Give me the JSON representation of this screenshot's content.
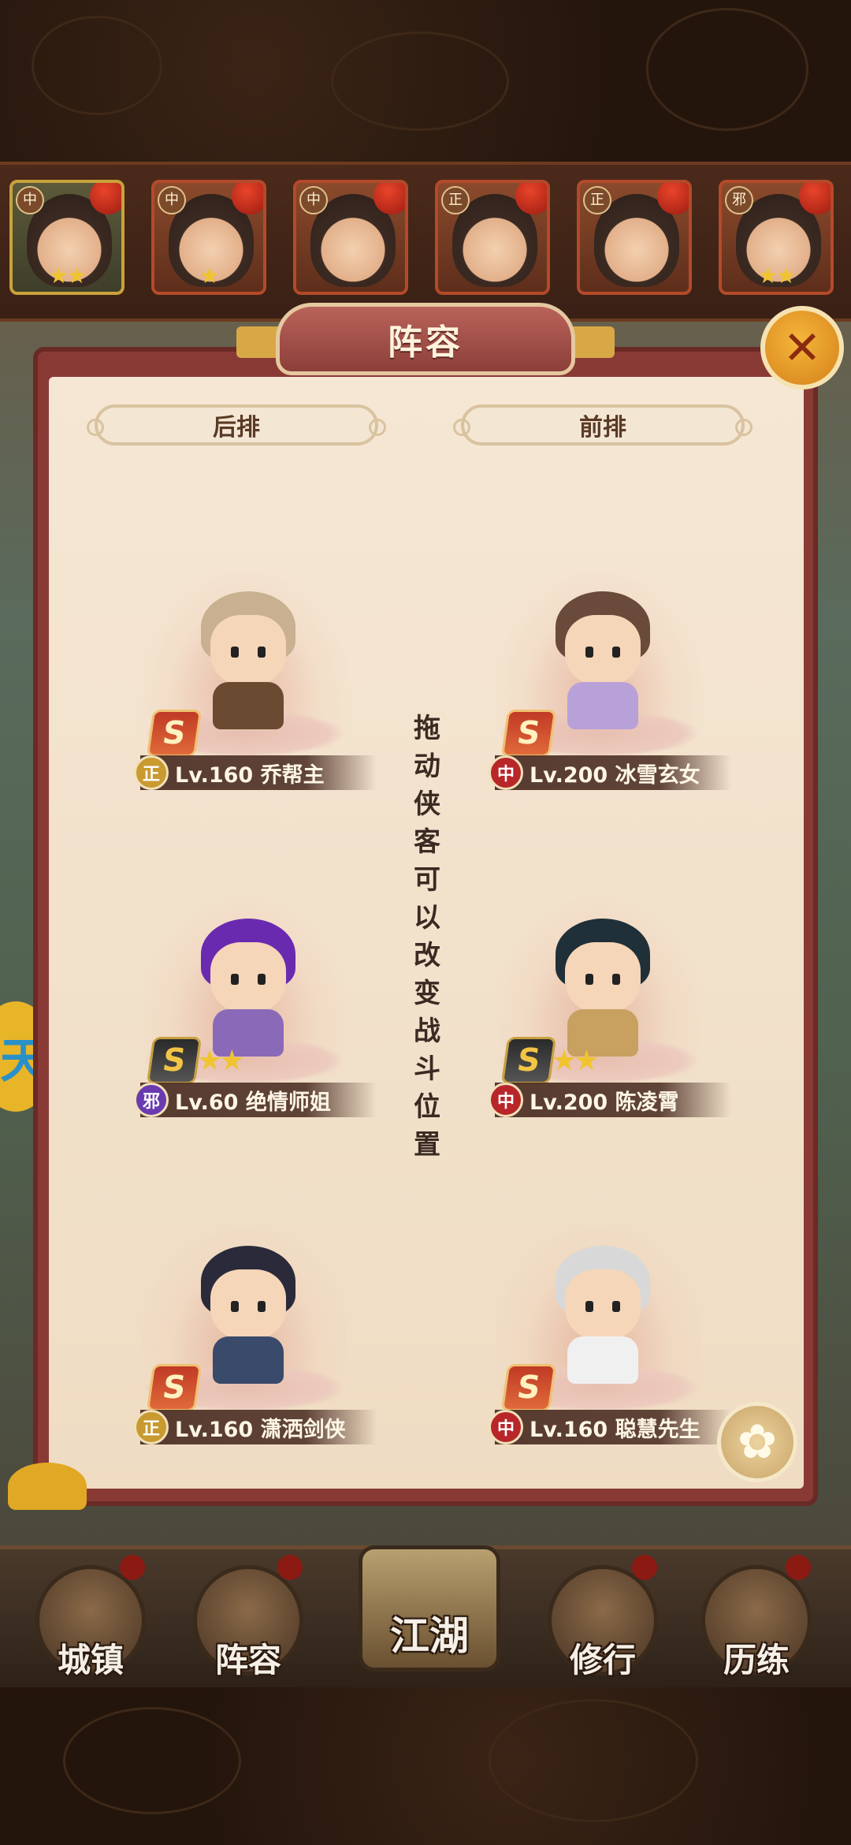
{
  "hero_strip": [
    {
      "faction": "中",
      "stars": "★★",
      "selected": true
    },
    {
      "faction": "中",
      "stars": "★",
      "selected": false
    },
    {
      "faction": "中",
      "stars": "",
      "selected": false
    },
    {
      "faction": "正",
      "stars": "",
      "selected": false
    },
    {
      "faction": "正",
      "stars": "",
      "selected": false
    },
    {
      "faction": "邪",
      "stars": "★★",
      "selected": false
    }
  ],
  "panel": {
    "title": "阵容",
    "close_icon": "✕",
    "back_row_label": "后排",
    "front_row_label": "前排",
    "hint": "拖动侠客可以改变战斗位置",
    "flower_icon": "✿"
  },
  "side_badge": "天",
  "slots": [
    {
      "rank": "S",
      "rank_style": "red",
      "stars": "",
      "faction": "正",
      "faction_class": "zheng",
      "label": "Lv.160 乔帮主",
      "hair": "#c8b090",
      "body": "#6a4a30"
    },
    {
      "rank": "S",
      "rank_style": "red",
      "stars": "",
      "faction": "中",
      "faction_class": "zhong",
      "label": "Lv.200 冰雪玄女",
      "hair": "#6a4a3a",
      "body": "#b8a0d8"
    },
    {
      "rank": "S",
      "rank_style": "dark",
      "stars": "★★",
      "faction": "邪",
      "faction_class": "xie",
      "label": "Lv.60 绝情师姐",
      "hair": "#6a2ab0",
      "body": "#8a6ab8"
    },
    {
      "rank": "S",
      "rank_style": "dark",
      "stars": "★★",
      "faction": "中",
      "faction_class": "zhong",
      "label": "Lv.200 陈凌霄",
      "hair": "#203038",
      "body": "#c8a060"
    },
    {
      "rank": "S",
      "rank_style": "red",
      "stars": "",
      "faction": "正",
      "faction_class": "zheng",
      "label": "Lv.160 潇洒剑侠",
      "hair": "#2a2a3a",
      "body": "#3a4a6a"
    },
    {
      "rank": "S",
      "rank_style": "red",
      "stars": "",
      "faction": "中",
      "faction_class": "zhong",
      "label": "Lv.160 聪慧先生",
      "hair": "#d8d8d8",
      "body": "#f0f0f0"
    }
  ],
  "nav": [
    {
      "label": "城镇"
    },
    {
      "label": "阵容"
    },
    {
      "label": "江湖"
    },
    {
      "label": "修行"
    },
    {
      "label": "历练"
    }
  ]
}
